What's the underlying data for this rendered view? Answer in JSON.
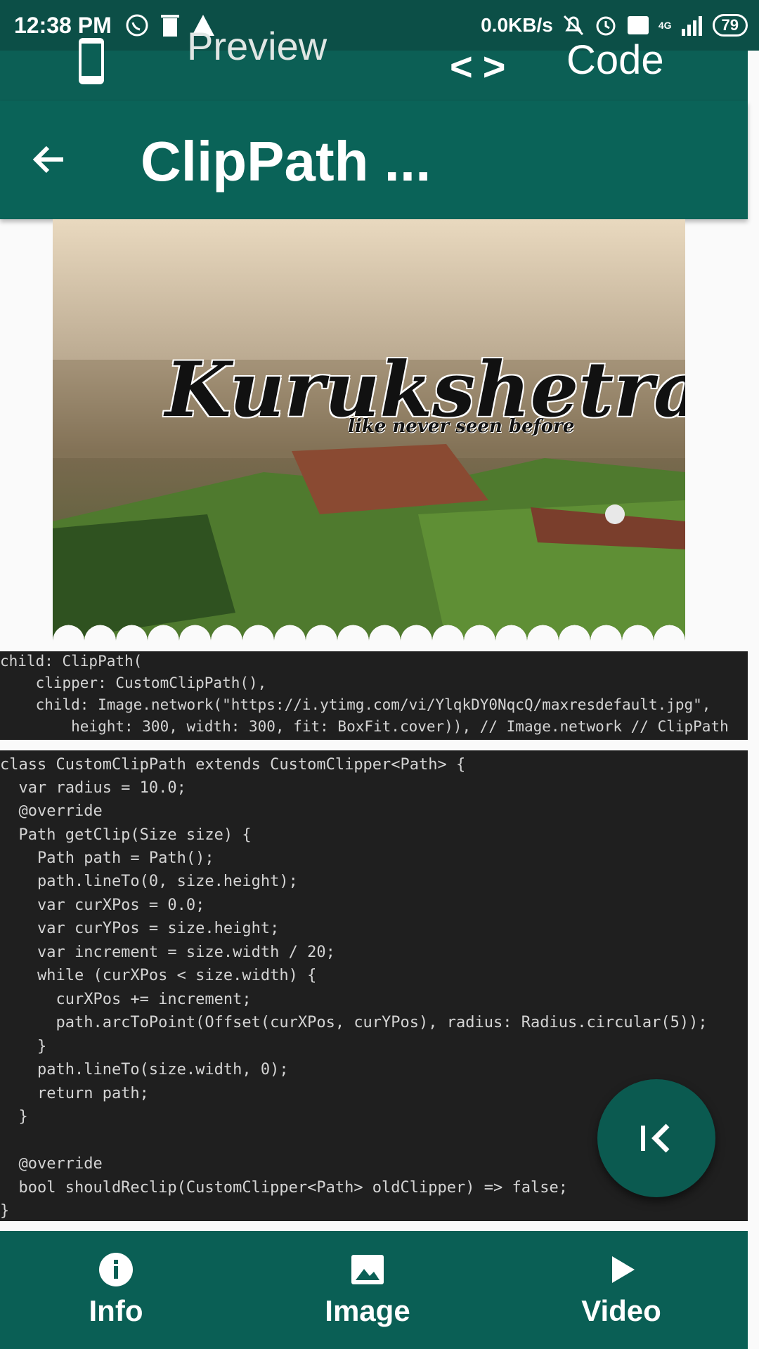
{
  "status_bar": {
    "time": "12:38 PM",
    "network_speed": "0.0KB/s",
    "signal_label": "4G",
    "battery": "79"
  },
  "tab_bar": {
    "preview_label": "Preview",
    "code_label": "Code"
  },
  "app_bar": {
    "title": "ClipPath ..."
  },
  "image": {
    "title_text": "Kurukshetra",
    "subtitle_text": "like never seen before"
  },
  "code_block_1": {
    "lines": [
      "child: ClipPath(",
      "    clipper: CustomClipPath(),",
      "    child: Image.network(\"https://i.ytimg.com/vi/YlqkDY0NqcQ/maxresdefault.jpg\",",
      "        height: 300, width: 300, fit: BoxFit.cover)), // Image.network // ClipPath"
    ]
  },
  "code_block_2": {
    "lines": [
      "class CustomClipPath extends CustomClipper<Path> {",
      "  var radius = 10.0;",
      "  @override",
      "  Path getClip(Size size) {",
      "    Path path = Path();",
      "    path.lineTo(0, size.height);",
      "    var curXPos = 0.0;",
      "    var curYPos = size.height;",
      "    var increment = size.width / 20;",
      "    while (curXPos < size.width) {",
      "      curXPos += increment;",
      "      path.arcToPoint(Offset(curXPos, curYPos), radius: Radius.circular(5));",
      "    }",
      "    path.lineTo(size.width, 0);",
      "    return path;",
      "  }",
      "",
      "  @override",
      "  bool shouldReclip(CustomClipper<Path> oldClipper) => false;",
      "}"
    ]
  },
  "bottom_nav": {
    "items": [
      {
        "label": "Info",
        "icon": "info-icon"
      },
      {
        "label": "Image",
        "icon": "image-icon"
      },
      {
        "label": "Video",
        "icon": "play-icon"
      }
    ]
  },
  "colors": {
    "primary": "#0a6358",
    "primary_dark": "#0c4f47",
    "code_bg": "#1f1f1f"
  }
}
